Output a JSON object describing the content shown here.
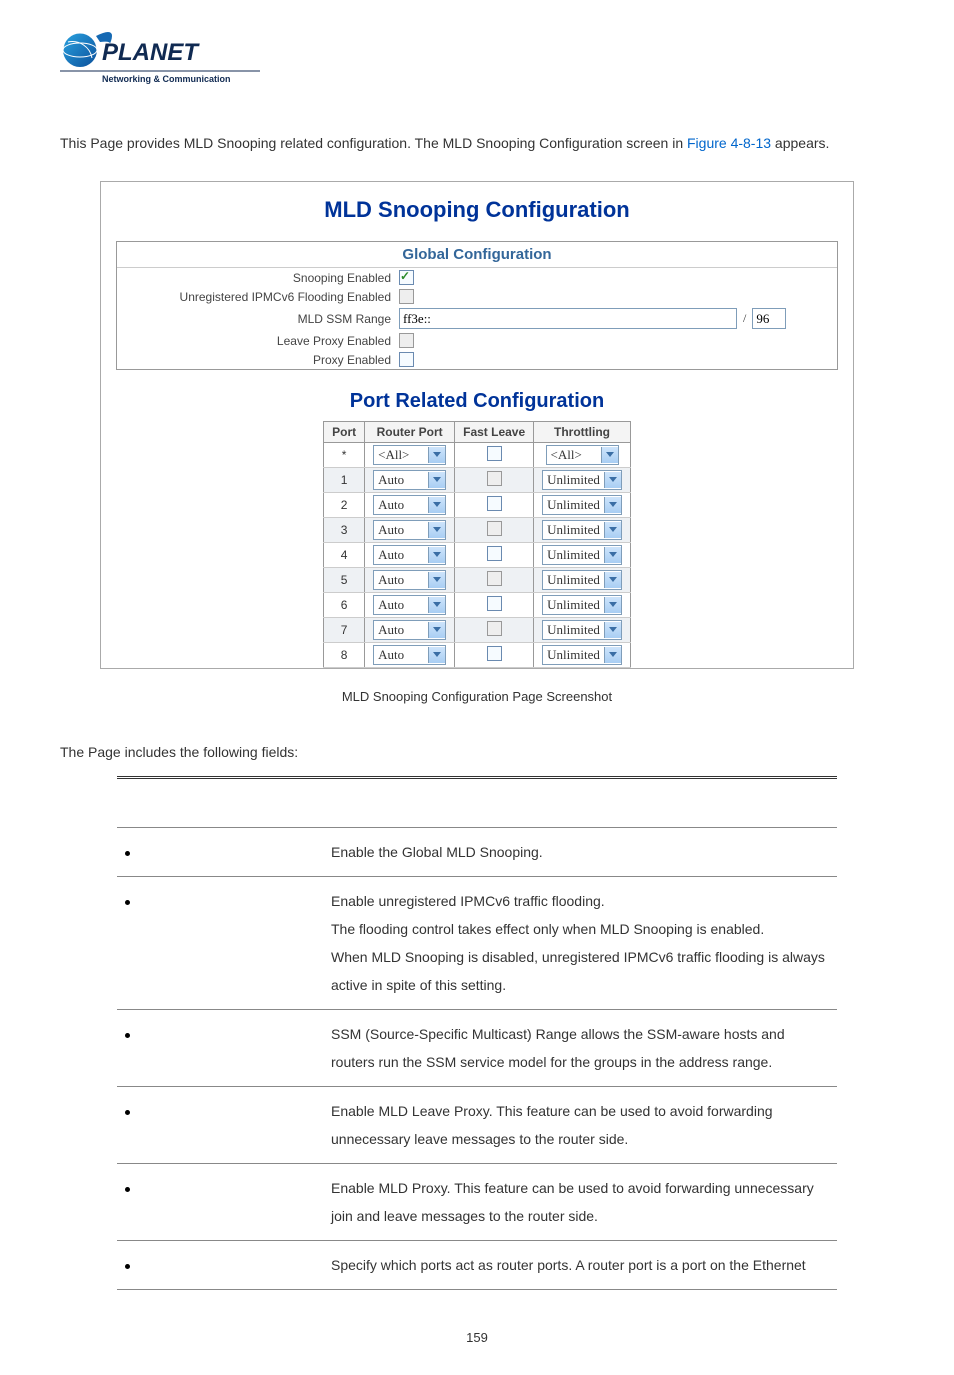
{
  "logo": {
    "brand": "PLANET",
    "tagline": "Networking & Communication"
  },
  "intro": {
    "prefix": "This Page provides MLD Snooping related configuration. The MLD Snooping Configuration screen in ",
    "link": "Figure 4-8-13",
    "suffix": " appears."
  },
  "screenshot": {
    "title": "MLD Snooping Configuration",
    "global": {
      "header": "Global Configuration",
      "rows": {
        "snooping_enabled": "Snooping Enabled",
        "unreg_flooding": "Unregistered IPMCv6 Flooding Enabled",
        "ssm_range": "MLD SSM Range",
        "leave_proxy": "Leave Proxy Enabled",
        "proxy_enabled": "Proxy Enabled"
      },
      "ssm_prefix_value": "ff3e::",
      "ssm_sep": "/",
      "ssm_len_value": "96"
    },
    "port_section_title": "Port Related Configuration",
    "port_headers": {
      "port": "Port",
      "router_port": "Router Port",
      "fast_leave": "Fast Leave",
      "throttling": "Throttling"
    },
    "port_rows": [
      {
        "port": "*",
        "router_port": "<All>",
        "throttling": "<All>",
        "alt": false
      },
      {
        "port": "1",
        "router_port": "Auto",
        "throttling": "Unlimited",
        "alt": true
      },
      {
        "port": "2",
        "router_port": "Auto",
        "throttling": "Unlimited",
        "alt": false
      },
      {
        "port": "3",
        "router_port": "Auto",
        "throttling": "Unlimited",
        "alt": true
      },
      {
        "port": "4",
        "router_port": "Auto",
        "throttling": "Unlimited",
        "alt": false
      },
      {
        "port": "5",
        "router_port": "Auto",
        "throttling": "Unlimited",
        "alt": true
      },
      {
        "port": "6",
        "router_port": "Auto",
        "throttling": "Unlimited",
        "alt": false
      },
      {
        "port": "7",
        "router_port": "Auto",
        "throttling": "Unlimited",
        "alt": true
      },
      {
        "port": "8",
        "router_port": "Auto",
        "throttling": "Unlimited",
        "alt": false
      }
    ]
  },
  "caption": "MLD Snooping Configuration Page Screenshot",
  "fields_intro": "The Page includes the following fields:",
  "fields": [
    {
      "desc": "Enable the Global MLD Snooping."
    },
    {
      "desc": "Enable unregistered IPMCv6 traffic flooding.\nThe flooding control takes effect only when MLD Snooping is enabled.\nWhen MLD Snooping is disabled, unregistered IPMCv6 traffic flooding is always active in spite of this setting."
    },
    {
      "desc": "SSM (Source-Specific Multicast) Range allows the SSM-aware hosts and routers run the SSM service model for the groups in the address range."
    },
    {
      "desc": "Enable MLD Leave Proxy. This feature can be used to avoid forwarding unnecessary leave messages to the router side."
    },
    {
      "desc": "Enable MLD Proxy. This feature can be used to avoid forwarding unnecessary join and leave messages to the router side."
    },
    {
      "desc": "Specify which ports act as router ports. A router port is a port on the Ethernet"
    }
  ],
  "page_number": "159"
}
